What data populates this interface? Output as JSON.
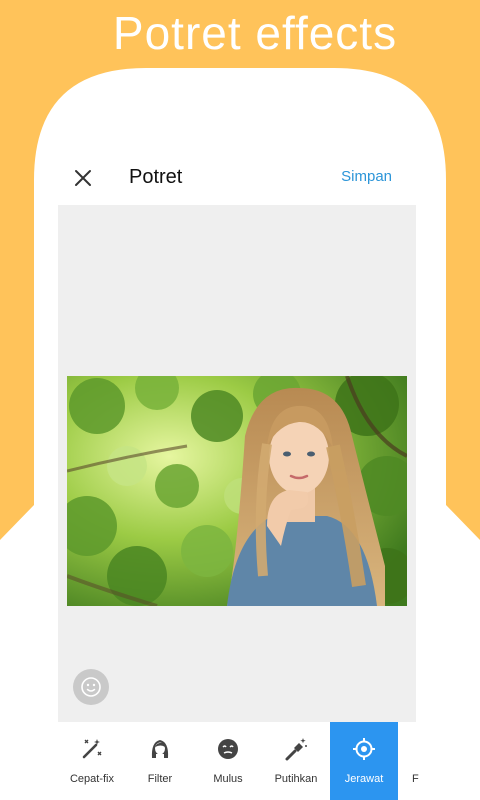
{
  "banner": {
    "title": "Potret effects"
  },
  "colors": {
    "background": "#FFC35A",
    "accent": "#2C95F0",
    "save_link": "#2C95D8"
  },
  "header": {
    "close_icon": "close-icon",
    "title": "Potret",
    "save_label": "Simpan"
  },
  "canvas": {
    "face_button_icon": "face-icon"
  },
  "toolbar": {
    "items": [
      {
        "label": "Cepat-fix",
        "icon": "magic-wand-icon"
      },
      {
        "label": "Filter",
        "icon": "woman-face-icon"
      },
      {
        "label": "Mulus",
        "icon": "smooth-face-icon"
      },
      {
        "label": "Putihkan",
        "icon": "whiten-brush-icon"
      },
      {
        "label": "Jerawat",
        "icon": "target-icon",
        "active": true
      }
    ],
    "partial_label": "F"
  }
}
